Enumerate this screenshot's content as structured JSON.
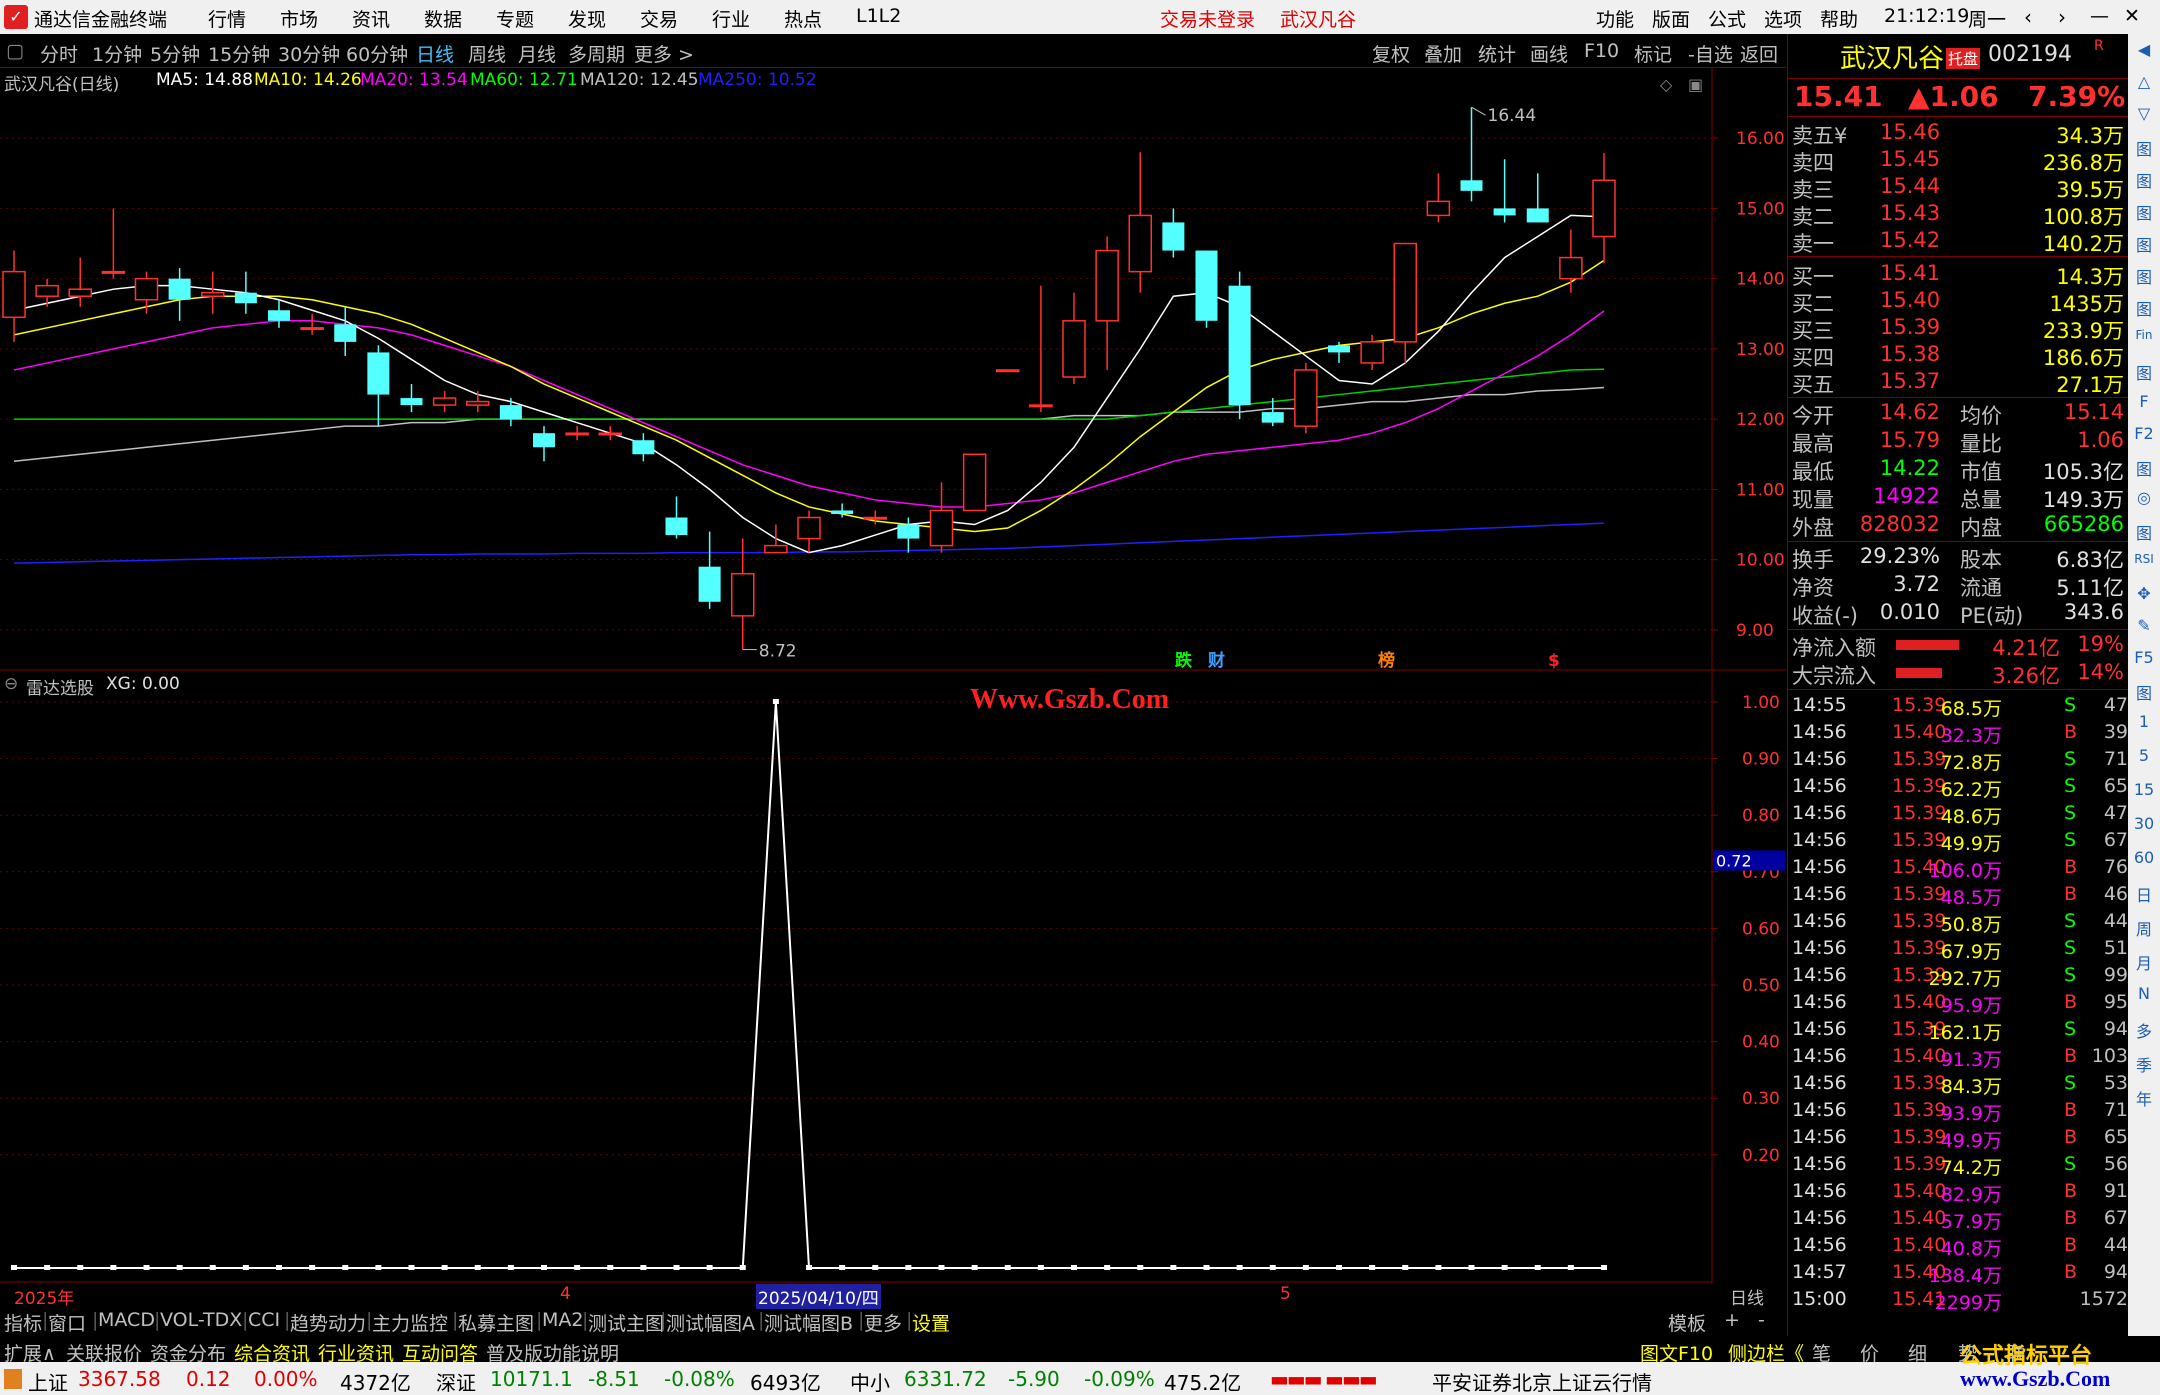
{
  "titlebar": {
    "app_name": "通达信金融终端",
    "menu": [
      "行情",
      "市场",
      "资讯",
      "数据",
      "专题",
      "发现",
      "交易",
      "行业",
      "热点",
      "L1L2"
    ],
    "trade_status": "交易未登录",
    "stock_name": "武汉凡谷",
    "right_menu": [
      "功能",
      "版面",
      "公式",
      "选项",
      "帮助"
    ],
    "clock": "21:12:19",
    "weekday": "周一",
    "nav_icons": [
      "back-icon",
      "forward-icon",
      "restore-icon",
      "minimize-icon",
      "close-icon"
    ]
  },
  "periodbar": {
    "periods": [
      "分时",
      "1分钟",
      "5分钟",
      "15分钟",
      "30分钟",
      "60分钟",
      "日线",
      "周线",
      "月线",
      "多周期",
      "更多 >"
    ],
    "selected": "日线",
    "right_buttons": [
      "复权",
      "叠加",
      "统计",
      "画线",
      "F10",
      "标记",
      "-自选",
      "返回"
    ]
  },
  "main_chart": {
    "label": "武汉凡谷(日线)",
    "ma": [
      {
        "text": "MA5: 14.88",
        "color": "#ffffff"
      },
      {
        "text": "MA10: 14.26",
        "color": "#ffff00"
      },
      {
        "text": "MA20: 13.54",
        "color": "#ff00ff"
      },
      {
        "text": "MA60: 12.71",
        "color": "#00ff00"
      },
      {
        "text": "MA120: 12.45",
        "color": "#c0c0c0"
      },
      {
        "text": "MA250: 10.52",
        "color": "#2020ff"
      }
    ],
    "yticks": [
      "16.00",
      "15.00",
      "14.00",
      "13.00",
      "12.00",
      "11.00",
      "10.00",
      "9.00"
    ],
    "high_label": "16.44",
    "low_label": "8.72",
    "events": [
      {
        "t": "跌",
        "c": "#00ff00"
      },
      {
        "t": "财",
        "c": "#40a0ff"
      },
      {
        "t": "榜",
        "c": "#ff8000"
      },
      {
        "t": "$",
        "c": "#ff2020"
      }
    ]
  },
  "chart_data": {
    "type": "candlestick",
    "y_range": [
      8.6,
      16.6
    ],
    "candles": [
      [
        13.45,
        14.1,
        14.4,
        13.1
      ],
      [
        13.75,
        13.9,
        14.0,
        13.6
      ],
      [
        13.75,
        13.85,
        14.3,
        13.6
      ],
      [
        14.1,
        14.1,
        15.0,
        14.0
      ],
      [
        13.7,
        14.0,
        14.1,
        13.5
      ],
      [
        14.0,
        13.7,
        14.15,
        13.4
      ],
      [
        13.75,
        13.8,
        14.1,
        13.5
      ],
      [
        13.8,
        13.65,
        14.1,
        13.5
      ],
      [
        13.55,
        13.4,
        13.7,
        13.3
      ],
      [
        13.3,
        13.3,
        13.5,
        13.2
      ],
      [
        13.35,
        13.1,
        13.6,
        12.9
      ],
      [
        12.95,
        12.35,
        13.05,
        11.9
      ],
      [
        12.3,
        12.2,
        12.5,
        12.1
      ],
      [
        12.2,
        12.3,
        12.4,
        12.1
      ],
      [
        12.2,
        12.25,
        12.4,
        12.1
      ],
      [
        12.2,
        12.0,
        12.3,
        11.9
      ],
      [
        11.8,
        11.6,
        11.9,
        11.4
      ],
      [
        11.8,
        11.8,
        11.9,
        11.7
      ],
      [
        11.8,
        11.8,
        11.9,
        11.7
      ],
      [
        11.7,
        11.5,
        11.8,
        11.4
      ],
      [
        10.6,
        10.35,
        10.9,
        10.3
      ],
      [
        9.9,
        9.4,
        10.4,
        9.3
      ],
      [
        9.2,
        9.8,
        10.3,
        8.72
      ],
      [
        10.1,
        10.2,
        10.5,
        10.1
      ],
      [
        10.3,
        10.6,
        10.7,
        10.1
      ],
      [
        10.7,
        10.65,
        10.8,
        10.6
      ],
      [
        10.6,
        10.6,
        10.7,
        10.5
      ],
      [
        10.5,
        10.3,
        10.6,
        10.1
      ],
      [
        10.2,
        10.7,
        11.1,
        10.1
      ],
      [
        10.7,
        11.5,
        11.5,
        10.7
      ],
      [
        12.7,
        12.7,
        12.7,
        12.7
      ],
      [
        12.2,
        12.2,
        13.9,
        12.1
      ],
      [
        12.6,
        13.4,
        13.8,
        12.5
      ],
      [
        13.4,
        14.4,
        14.6,
        12.7
      ],
      [
        14.1,
        14.9,
        15.8,
        13.8
      ],
      [
        14.8,
        14.4,
        15.0,
        14.3
      ],
      [
        14.4,
        13.4,
        14.4,
        13.3
      ],
      [
        13.9,
        12.2,
        14.1,
        12.0
      ],
      [
        12.1,
        11.95,
        12.3,
        11.9
      ],
      [
        11.9,
        12.7,
        12.8,
        11.8
      ],
      [
        13.05,
        12.95,
        13.1,
        12.8
      ],
      [
        12.8,
        13.1,
        13.2,
        12.7
      ],
      [
        13.1,
        14.5,
        14.5,
        12.8
      ],
      [
        14.9,
        15.1,
        15.5,
        14.8
      ],
      [
        15.4,
        15.25,
        16.44,
        15.1
      ],
      [
        15.0,
        14.9,
        15.7,
        14.8
      ],
      [
        15.0,
        14.8,
        15.5,
        14.8
      ],
      [
        14.0,
        14.3,
        14.7,
        13.8
      ],
      [
        14.6,
        15.4,
        15.79,
        14.22
      ]
    ],
    "ma5": [
      13.55,
      13.65,
      13.75,
      13.85,
      13.9,
      13.9,
      13.85,
      13.8,
      13.7,
      13.55,
      13.4,
      13.15,
      12.85,
      12.55,
      12.35,
      12.25,
      12.1,
      11.95,
      11.8,
      11.65,
      11.35,
      11.0,
      10.6,
      10.3,
      10.1,
      10.2,
      10.35,
      10.5,
      10.55,
      10.5,
      10.7,
      11.1,
      11.6,
      12.3,
      13.0,
      13.75,
      13.8,
      13.6,
      13.25,
      12.9,
      12.55,
      12.5,
      12.8,
      13.25,
      13.8,
      14.3,
      14.6,
      14.9,
      14.88
    ],
    "ma10": [
      13.2,
      13.3,
      13.4,
      13.5,
      13.6,
      13.7,
      13.75,
      13.75,
      13.75,
      13.7,
      13.6,
      13.5,
      13.35,
      13.15,
      12.95,
      12.75,
      12.5,
      12.3,
      12.1,
      11.9,
      11.7,
      11.45,
      11.2,
      10.95,
      10.75,
      10.65,
      10.55,
      10.5,
      10.45,
      10.4,
      10.45,
      10.7,
      11.0,
      11.35,
      11.75,
      12.1,
      12.45,
      12.7,
      12.85,
      12.95,
      13.05,
      13.1,
      13.15,
      13.3,
      13.5,
      13.65,
      13.75,
      13.95,
      14.26
    ],
    "ma20": [
      12.7,
      12.8,
      12.9,
      13.0,
      13.1,
      13.2,
      13.3,
      13.35,
      13.4,
      13.4,
      13.35,
      13.3,
      13.2,
      13.05,
      12.9,
      12.75,
      12.55,
      12.35,
      12.15,
      11.95,
      11.75,
      11.55,
      11.35,
      11.2,
      11.05,
      10.95,
      10.85,
      10.8,
      10.75,
      10.75,
      10.8,
      10.85,
      10.95,
      11.1,
      11.25,
      11.4,
      11.5,
      11.55,
      11.6,
      11.65,
      11.7,
      11.8,
      11.95,
      12.15,
      12.4,
      12.65,
      12.9,
      13.2,
      13.54
    ],
    "ma60": [
      12.0,
      12.0,
      12.0,
      12.0,
      12.0,
      12.0,
      12.0,
      12.0,
      12.0,
      12.0,
      12.0,
      12.0,
      12.0,
      12.0,
      12.0,
      12.0,
      12.0,
      12.0,
      12.0,
      12.0,
      12.0,
      12.0,
      12.0,
      12.0,
      12.0,
      12.0,
      12.0,
      12.0,
      12.0,
      12.0,
      12.0,
      12.0,
      12.0,
      12.0,
      12.05,
      12.1,
      12.15,
      12.2,
      12.25,
      12.3,
      12.35,
      12.4,
      12.45,
      12.5,
      12.55,
      12.6,
      12.65,
      12.7,
      12.71
    ],
    "ma120": [
      11.4,
      11.45,
      11.5,
      11.55,
      11.6,
      11.65,
      11.7,
      11.75,
      11.8,
      11.85,
      11.9,
      11.9,
      11.95,
      11.95,
      12.0,
      12.0,
      12.0,
      12.0,
      12.0,
      12.0,
      12.0,
      12.0,
      12.0,
      12.0,
      12.0,
      12.0,
      12.0,
      12.0,
      12.0,
      12.0,
      12.0,
      12.0,
      12.05,
      12.05,
      12.05,
      12.1,
      12.1,
      12.1,
      12.15,
      12.15,
      12.2,
      12.25,
      12.25,
      12.3,
      12.35,
      12.35,
      12.4,
      12.42,
      12.45
    ],
    "ma250": [
      9.95,
      9.96,
      9.97,
      9.98,
      9.99,
      10.0,
      10.01,
      10.02,
      10.03,
      10.04,
      10.05,
      10.06,
      10.07,
      10.07,
      10.08,
      10.08,
      10.08,
      10.09,
      10.09,
      10.09,
      10.1,
      10.1,
      10.1,
      10.1,
      10.11,
      10.11,
      10.12,
      10.13,
      10.14,
      10.15,
      10.16,
      10.18,
      10.2,
      10.22,
      10.24,
      10.26,
      10.28,
      10.3,
      10.32,
      10.34,
      10.36,
      10.38,
      10.4,
      10.42,
      10.44,
      10.46,
      10.48,
      10.5,
      10.52
    ],
    "xg": [
      0,
      0,
      0,
      0,
      0,
      0,
      0,
      0,
      0,
      0,
      0,
      0,
      0,
      0,
      0,
      0,
      0,
      0,
      0,
      0,
      0,
      0,
      0,
      1,
      0,
      0,
      0,
      0,
      0,
      0,
      0,
      0,
      0,
      0,
      0,
      0,
      0,
      0,
      0,
      0,
      0,
      0,
      0,
      0,
      0,
      0,
      0,
      0,
      0
    ]
  },
  "sub_chart": {
    "label": "雷达选股",
    "xg_label": "XG: 0.00",
    "yticks": [
      "1.00",
      "0.90",
      "0.80",
      "0.70",
      "0.60",
      "0.50",
      "0.40",
      "0.30",
      "0.20"
    ],
    "cursor_value": "0.72",
    "watermark": "Www.Gszb.Com"
  },
  "xaxis": {
    "labels": [
      "2025年",
      "4",
      "2025/04/10/四",
      "5"
    ],
    "period": "日线"
  },
  "tabs": [
    "指标",
    "窗口",
    "MACD",
    "VOL-TDX",
    "CCI",
    "趋势动力",
    "主力监控",
    "私募主图",
    "MA2",
    "测试主图",
    "测试幅图A",
    "测试幅图B",
    "更多",
    "设置"
  ],
  "tabs_right": [
    "模板",
    "+",
    "-"
  ],
  "tabs2": [
    {
      "t": "扩展∧",
      "c": "#c0c0c0"
    },
    {
      "t": "关联报价",
      "c": "#c0c0c0"
    },
    {
      "t": "资金分布",
      "c": "#c0c0c0"
    },
    {
      "t": "综合资讯",
      "c": "#ffff00"
    },
    {
      "t": "行业资讯",
      "c": "#ffff00"
    },
    {
      "t": "互动问答",
      "c": "#ffff00"
    },
    {
      "t": "普及版功能说明",
      "c": "#c0c0c0"
    }
  ],
  "tabs2_right": [
    "图文F10",
    "侧边栏《",
    "笔",
    "价",
    "细",
    "势",
    "联"
  ],
  "quote": {
    "name": "武汉凡谷",
    "badge": "托盘",
    "code": "002194",
    "mark": "R",
    "price": "15.41",
    "change": "▲1.06",
    "pct": "7.39%",
    "sells": [
      {
        "label": "卖五¥",
        "price": "15.46",
        "vol": "34.3万"
      },
      {
        "label": "卖四",
        "price": "15.45",
        "vol": "236.8万"
      },
      {
        "label": "卖三",
        "price": "15.44",
        "vol": "39.5万"
      },
      {
        "label": "卖二",
        "price": "15.43",
        "vol": "100.8万"
      },
      {
        "label": "卖一",
        "price": "15.42",
        "vol": "140.2万"
      }
    ],
    "buys": [
      {
        "label": "买一",
        "price": "15.41",
        "vol": "14.3万"
      },
      {
        "label": "买二",
        "price": "15.40",
        "vol": "1435万"
      },
      {
        "label": "买三",
        "price": "15.39",
        "vol": "233.9万"
      },
      {
        "label": "买四",
        "price": "15.38",
        "vol": "186.6万"
      },
      {
        "label": "买五",
        "price": "15.37",
        "vol": "27.1万"
      }
    ],
    "stats": [
      {
        "l1": "今开",
        "v1": "14.62",
        "c1": "#ff3030",
        "l2": "均价",
        "v2": "15.14",
        "c2": "#ff3030"
      },
      {
        "l1": "最高",
        "v1": "15.79",
        "c1": "#ff3030",
        "l2": "量比",
        "v2": "1.06",
        "c2": "#ff3030"
      },
      {
        "l1": "最低",
        "v1": "14.22",
        "c1": "#00ff00",
        "l2": "市值",
        "v2": "105.3亿",
        "c2": "#e0e0e0"
      },
      {
        "l1": "现量",
        "v1": "14922",
        "c1": "#ff00ff",
        "l2": "总量",
        "v2": "149.3万",
        "c2": "#e0e0e0"
      },
      {
        "l1": "外盘",
        "v1": "828032",
        "c1": "#ff3030",
        "l2": "内盘",
        "v2": "665286",
        "c2": "#00ff00"
      }
    ],
    "stats2": [
      {
        "l1": "换手",
        "v1": "29.23%",
        "l2": "股本",
        "v2": "6.83亿"
      },
      {
        "l1": "净资",
        "v1": "3.72",
        "l2": "流通",
        "v2": "5.11亿"
      },
      {
        "l1": "收益(-)",
        "v1": "0.010",
        "l2": "PE(动)",
        "v2": "343.6"
      }
    ],
    "flows": [
      {
        "label": "净流入额",
        "value": "4.21亿",
        "pct": "19%",
        "bar": 0.9
      },
      {
        "label": "大宗流入",
        "value": "3.26亿",
        "pct": "14%",
        "bar": 0.65
      }
    ]
  },
  "ticks": [
    [
      "14:55",
      "15.39",
      "68.5万",
      "S",
      "47"
    ],
    [
      "14:56",
      "15.40",
      "32.3万",
      "B",
      "39"
    ],
    [
      "14:56",
      "15.39",
      "72.8万",
      "S",
      "71"
    ],
    [
      "14:56",
      "15.39",
      "62.2万",
      "S",
      "65"
    ],
    [
      "14:56",
      "15.39",
      "48.6万",
      "S",
      "47"
    ],
    [
      "14:56",
      "15.39",
      "49.9万",
      "S",
      "67"
    ],
    [
      "14:56",
      "15.40",
      "106.0万",
      "B",
      "76"
    ],
    [
      "14:56",
      "15.39",
      "48.5万",
      "B",
      "46"
    ],
    [
      "14:56",
      "15.39",
      "50.8万",
      "S",
      "44"
    ],
    [
      "14:56",
      "15.39",
      "67.9万",
      "S",
      "51"
    ],
    [
      "14:56",
      "15.39",
      "292.7万",
      "S",
      "99"
    ],
    [
      "14:56",
      "15.40",
      "95.9万",
      "B",
      "95"
    ],
    [
      "14:56",
      "15.39",
      "162.1万",
      "S",
      "94"
    ],
    [
      "14:56",
      "15.40",
      "91.3万",
      "B",
      "103"
    ],
    [
      "14:56",
      "15.39",
      "84.3万",
      "S",
      "53"
    ],
    [
      "14:56",
      "15.39",
      "93.9万",
      "B",
      "71"
    ],
    [
      "14:56",
      "15.39",
      "49.9万",
      "B",
      "65"
    ],
    [
      "14:56",
      "15.39",
      "74.2万",
      "S",
      "56"
    ],
    [
      "14:56",
      "15.40",
      "82.9万",
      "B",
      "91"
    ],
    [
      "14:56",
      "15.40",
      "57.9万",
      "B",
      "67"
    ],
    [
      "14:56",
      "15.40",
      "40.8万",
      "B",
      "44"
    ],
    [
      "14:57",
      "15.40",
      "138.4万",
      "B",
      "94"
    ],
    [
      "15:00",
      "15.41",
      "2299万",
      "",
      "1572"
    ]
  ],
  "rtool": [
    "◀",
    "△",
    "▽",
    "图",
    "图",
    "图",
    "图",
    "图",
    "图",
    "Fin",
    "图",
    "F",
    "F2",
    "图",
    "◎",
    "图",
    "RSI",
    "✥",
    "✎",
    "F5",
    "图",
    "1",
    "5",
    "15",
    "30",
    "60",
    "日",
    "周",
    "月",
    "N",
    "多",
    "季",
    "年"
  ],
  "statusbar": {
    "sh_label": "上证",
    "sh_value": "3367.58",
    "sh_chg": "0.12",
    "sh_pct": "0.00%",
    "sh_amt": "4372亿",
    "sz_label": "深证",
    "sz_value": "10171.1",
    "sz_chg": "-8.51",
    "sz_pct": "-0.08%",
    "sz_amt": "6493亿",
    "zx_label": "中小",
    "zx_value": "6331.72",
    "zx_chg": "-5.90",
    "zx_pct": "-0.09%",
    "zx_amt": "475.2亿",
    "server": "平安证券北京上证云行情"
  },
  "watermark2": "公式指标平台",
  "watermark3": "www.Gszb.Com"
}
